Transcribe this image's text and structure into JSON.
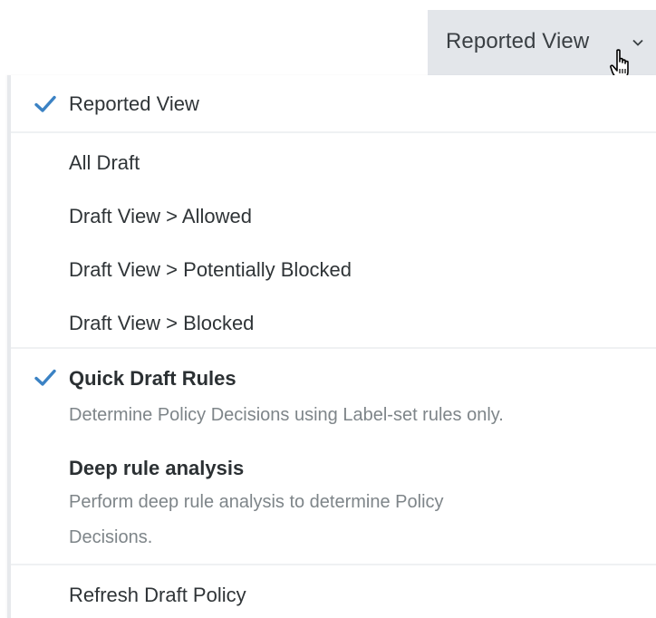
{
  "trigger": {
    "label": "Reported View"
  },
  "icons": {
    "chevron": "chevron-down-icon",
    "cursor": "hand-pointer-cursor-icon",
    "check": "checkmark-icon"
  },
  "menu": {
    "reported_view": "Reported View",
    "all_draft": "All Draft",
    "draft_allowed": "Draft View > Allowed",
    "draft_potentially_blocked": "Draft View > Potentially Blocked",
    "draft_blocked": "Draft View > Blocked",
    "quick_rules": {
      "label": "Quick Draft Rules",
      "description": "Determine Policy Decisions using Label-set rules only."
    },
    "deep_analysis": {
      "label": "Deep rule analysis",
      "description_line1": "Perform deep rule analysis to determine Policy",
      "description_line2": "Decisions."
    },
    "refresh": "Refresh Draft Policy"
  },
  "colors": {
    "accent": "#3b82c4",
    "trigger_bg": "#e3e6ea",
    "text": "#2f3437",
    "muted_text": "#7e8589"
  }
}
